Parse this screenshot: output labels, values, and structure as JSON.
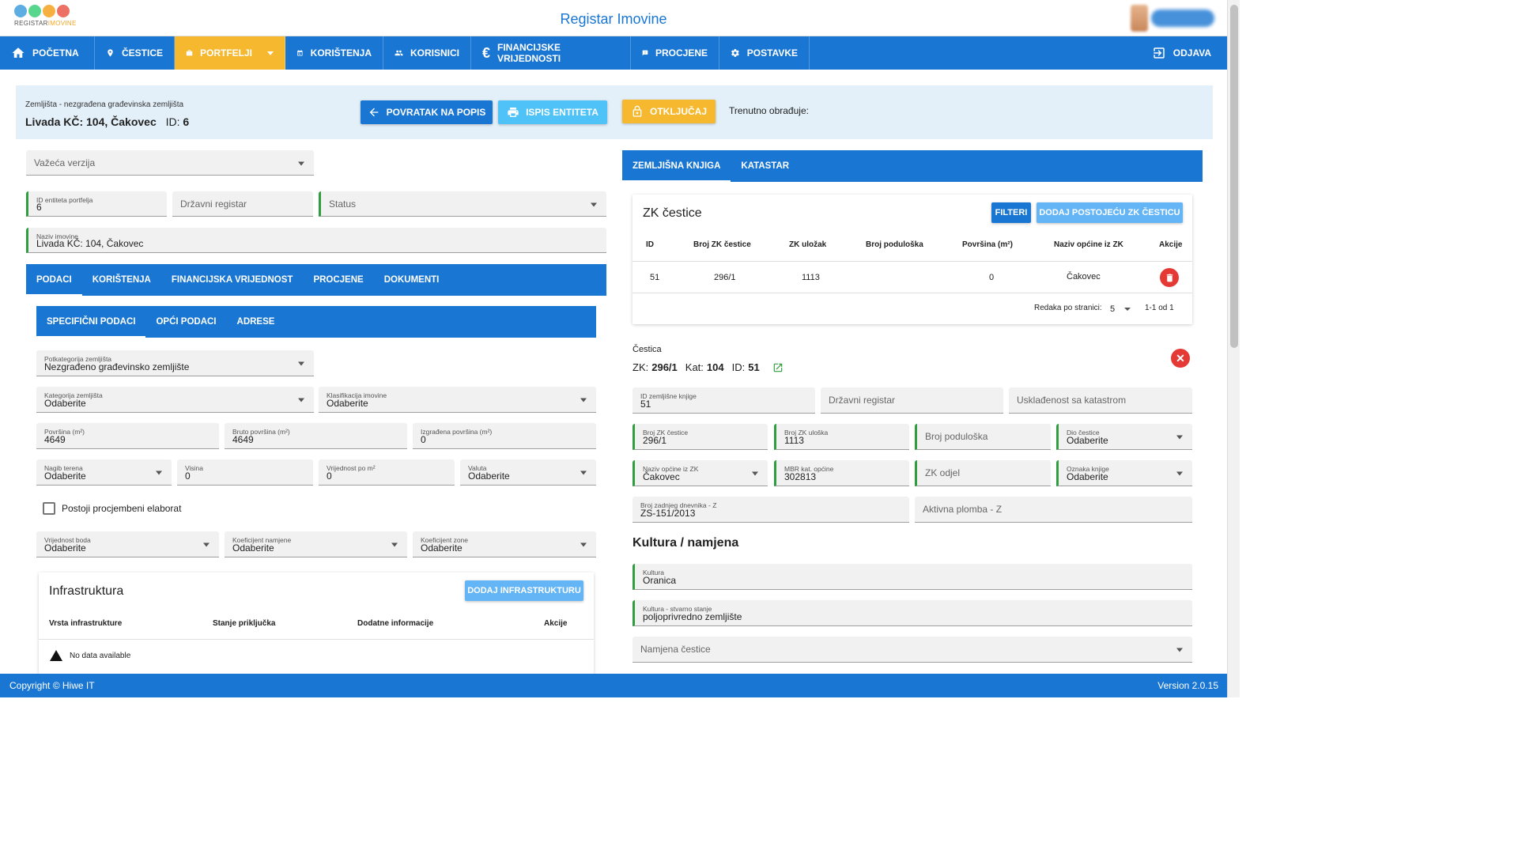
{
  "app": {
    "title": "Registar Imovine",
    "logo_text_a": "REGISTAR",
    "logo_text_b": "IMOVINE"
  },
  "nav": {
    "items": [
      {
        "label": "POČETNA",
        "icon": "home-icon"
      },
      {
        "label": "ČESTICE",
        "icon": "map-pin-icon"
      },
      {
        "label": "PORTFELJI",
        "icon": "briefcase-icon",
        "active": true
      },
      {
        "label": "KORIŠTENJA",
        "icon": "calendar-icon"
      },
      {
        "label": "KORISNICI",
        "icon": "users-icon"
      },
      {
        "label": "FINANCIJSKE VRIJEDNOSTI",
        "icon": "euro-icon"
      },
      {
        "label": "PROCJENE",
        "icon": "feedback-icon"
      },
      {
        "label": "POSTAVKE",
        "icon": "gear-icon"
      }
    ],
    "logout": "ODJAVA"
  },
  "header": {
    "subtitle": "Zemljišta - nezgrađena građevinska zemljišta",
    "title": "Livada KČ: 104, Čakovec",
    "id_label": "ID:",
    "id_value": "6",
    "btn_back": "POVRATAK NA POPIS",
    "btn_print": "ISPIS ENTITETA",
    "btn_unlock": "OTKLJUČAJ",
    "editing": "Trenutno obrađuje:"
  },
  "left": {
    "version_placeholder": "Važeća verzija",
    "id_entiteta": {
      "label": "ID entiteta portfelja",
      "value": "6"
    },
    "drzavni_registar": "Državni registar",
    "status": "Status",
    "naziv": {
      "label": "Naziv imovine",
      "value": "Livada KČ: 104, Čakovec"
    },
    "tabs": [
      "PODACI",
      "KORIŠTENJA",
      "FINANCIJSKA VRIJEDNOST",
      "PROCJENE",
      "DOKUMENTI"
    ],
    "subtabs": [
      "SPECIFIČNI PODACI",
      "OPĆI PODACI",
      "ADRESE"
    ],
    "potkategorija": {
      "label": "Potkategorija zemljišta",
      "value": "Nezgrađeno građevinsko zemljište"
    },
    "kategorija": {
      "label": "Kategorija zemljišta",
      "value": "Odaberite"
    },
    "klasifikacija": {
      "label": "Klasifikacija imovine",
      "value": "Odaberite"
    },
    "povrsina": {
      "label": "Površina (m²)",
      "value": "4649"
    },
    "bruto": {
      "label": "Bruto površina (m²)",
      "value": "4649"
    },
    "izgradena": {
      "label": "Izgrađena površina (m²)",
      "value": "0"
    },
    "nagib": {
      "label": "Nagib terena",
      "value": "Odaberite"
    },
    "visina": {
      "label": "Visina",
      "value": "0"
    },
    "vrijednost_m2": {
      "label": "Vrijednost po m²",
      "value": "0"
    },
    "valuta": {
      "label": "Valuta",
      "value": "Odaberite"
    },
    "elaborat": "Postoji procjembeni elaborat",
    "vrijednost_boda": {
      "label": "Vrijednost boda",
      "value": "Odaberite"
    },
    "koef_namjene": {
      "label": "Koeficijent namjene",
      "value": "Odaberite"
    },
    "koef_zone": {
      "label": "Koeficijent zone",
      "value": "Odaberite"
    },
    "infra": {
      "title": "Infrastruktura",
      "add_btn": "DODAJ INFRASTRUKTURU",
      "cols": [
        "Vrsta infrastrukture",
        "Stanje priključka",
        "Dodatne informacije",
        "Akcije"
      ],
      "empty": "No data available"
    }
  },
  "right": {
    "tabs": [
      "ZEMLJIŠNA KNJIGA",
      "KATASTAR"
    ],
    "zk": {
      "title": "ZK čestice",
      "filter_btn": "FILTERI",
      "add_btn": "DODAJ POSTOJEĆU ZK ČESTICU",
      "cols": [
        "ID",
        "Broj ZK čestice",
        "ZK uložak",
        "Broj poduloška",
        "Površina (m²)",
        "Naziv općine iz ZK",
        "Akcije"
      ],
      "rows": [
        {
          "id": "51",
          "broj": "296/1",
          "ulozak": "1113",
          "podulozak": "",
          "povrsina": "0",
          "opcina": "Čakovec"
        }
      ],
      "rows_per_page_label": "Redaka po stranici:",
      "rows_per_page": "5",
      "range": "1-1 od 1"
    },
    "cestica": {
      "label": "Čestica",
      "zk_label": "ZK:",
      "zk_value": "296/1",
      "kat_label": "Kat:",
      "kat_value": "104",
      "id_label": "ID:",
      "id_value": "51"
    },
    "id_zk": {
      "label": "ID zemljišne knjige",
      "value": "51"
    },
    "drzavni_registar": "Državni registar",
    "uskladenost": "Usklađenost sa katastrom",
    "broj_zk_cestice": {
      "label": "Broj ZK čestice",
      "value": "296/1"
    },
    "broj_zk_uloska": {
      "label": "Broj ZK uloška",
      "value": "1113"
    },
    "broj_poduloska": "Broj poduloška",
    "dio_cestice": {
      "label": "Dio čestice",
      "value": "Odaberite"
    },
    "naziv_opcine": {
      "label": "Naziv općine iz ZK",
      "value": "Čakovec"
    },
    "mbr": {
      "label": "MBR kat. općine",
      "value": "302813"
    },
    "zk_odjel": "ZK odjel",
    "oznaka_knjige": {
      "label": "Oznaka knjige",
      "value": "Odaberite"
    },
    "dnevnik": {
      "label": "Broj zadnjeg dnevnika - Z",
      "value": "ZS-151/2013"
    },
    "plomba": "Aktivna plomba - Z",
    "kultura_title": "Kultura / namjena",
    "kultura": {
      "label": "Kultura",
      "value": "Oranica"
    },
    "kultura_stanje": {
      "label": "Kultura - stvarno stanje",
      "value": "poljoprivredno zemljište"
    },
    "namjena": "Namjena čestice"
  },
  "footer": {
    "copyright": "Copyright © Hiwe IT",
    "version": "Version 2.0.15"
  },
  "colors": {
    "primary": "#1976d2",
    "accent": "#f5b82e",
    "light_btn": "#64b5f6",
    "required": "#2e9e3e",
    "danger": "#e53935"
  }
}
